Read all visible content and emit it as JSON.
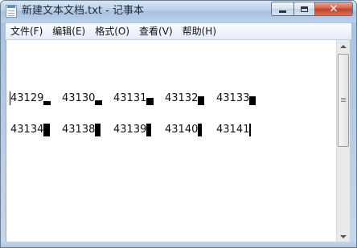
{
  "window": {
    "title": "新建文本文档.txt - 记事本",
    "close_symbol": "✕",
    "icons": [
      "notepad-icon",
      "minimize-icon",
      "maximize-icon",
      "close-icon"
    ]
  },
  "menu": {
    "file": "文件(F)",
    "edit": "编辑(E)",
    "format": "格式(O)",
    "view": "查看(V)",
    "help": "帮助(H)"
  },
  "document": {
    "lines": [
      [
        "43129",
        "43130",
        "43131",
        "43132",
        "43133"
      ],
      [
        "43134",
        "43138",
        "43139",
        "43140",
        "43141"
      ]
    ]
  },
  "colors": {
    "text": "#111111",
    "title_bar": "#b8cfe8",
    "close_button": "#c3402a"
  }
}
